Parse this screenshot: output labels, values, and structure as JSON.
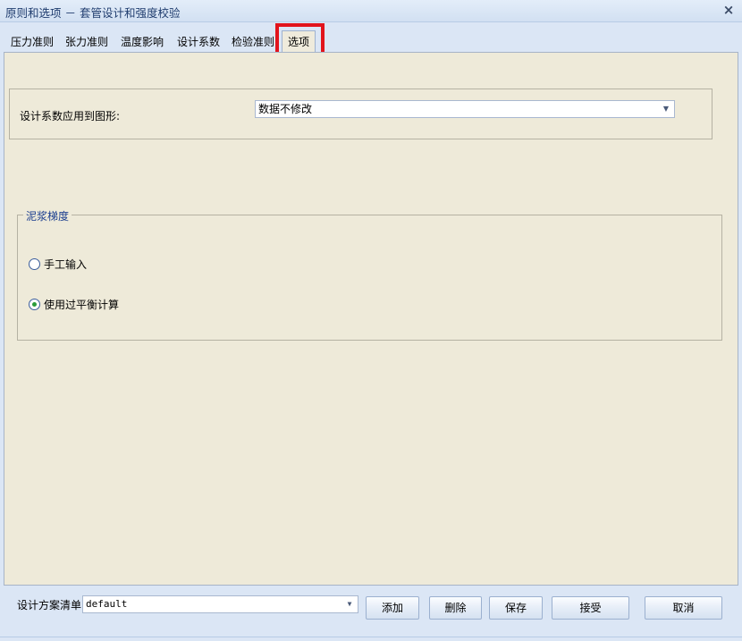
{
  "window": {
    "title": "原则和选项 － 套管设计和强度校验",
    "close_glyph": "×"
  },
  "tabs": [
    {
      "label": "压力准则",
      "active": false
    },
    {
      "label": "张力准则",
      "active": false
    },
    {
      "label": "温度影响",
      "active": false
    },
    {
      "label": "设计系数",
      "active": false
    },
    {
      "label": "检验准则",
      "active": false
    },
    {
      "label": "选项",
      "active": true
    }
  ],
  "design_factor": {
    "label": "设计系数应用到图形:",
    "selected": "数据不修改"
  },
  "mud_gradient": {
    "legend": "泥浆梯度",
    "options": [
      {
        "label": "手工输入",
        "checked": false
      },
      {
        "label": "使用过平衡计算",
        "checked": true
      }
    ]
  },
  "bottom": {
    "plan_list_label": "设计方案清单",
    "plan_list_value": "default",
    "buttons": {
      "add": "添加",
      "delete": "删除",
      "save": "保存",
      "accept": "接受",
      "cancel": "取消"
    }
  },
  "colors": {
    "panel_bg": "#eeead9",
    "chrome_bg": "#dbe6f5",
    "highlight": "#e2141c",
    "legend_text": "#1a3d8f"
  },
  "icons": {
    "close": "close-icon",
    "dropdown": "chevron-down-icon"
  }
}
